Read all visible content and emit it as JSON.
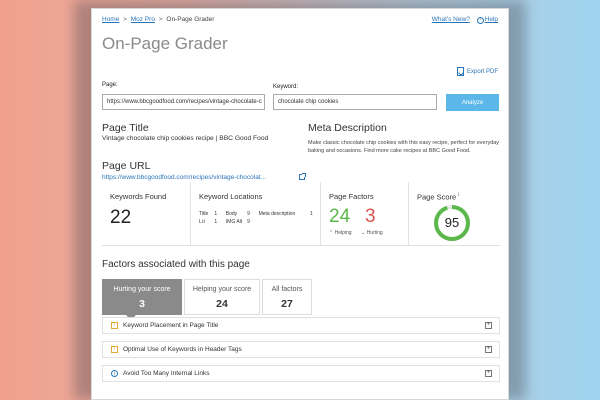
{
  "breadcrumb": {
    "home": "Home",
    "product": "Moz Pro",
    "current": "On-Page Grader",
    "sep": ">"
  },
  "toplinks": {
    "whats_new": "What's New?",
    "help_icon": "?",
    "help": "Help"
  },
  "page_title": "On-Page Grader",
  "export_label": "Export PDF",
  "form": {
    "page_label": "Page:",
    "page_value": "https://www.bbcgoodfood.com/recipes/vintage-chocolate-c",
    "keyword_label": "Keyword:",
    "keyword_value": "chocolate chip cookies",
    "analyze_label": "Analyze"
  },
  "results": {
    "page_title_heading": "Page Title",
    "page_title_value": "Vintage chocolate chip cookies recipe | BBC Good Food",
    "meta_heading": "Meta Description",
    "meta_value": "Make classic chocolate chip cookies with this easy recipe, perfect for everyday baking and occasions. Find more cake recipes at BBC Good Food.",
    "url_heading": "Page URL",
    "url_value": "https://www.bbcgoodfood.com/recipes/vintage-chocolat..."
  },
  "stats": {
    "keywords_found_label": "Keywords Found",
    "keywords_found_value": "22",
    "keyword_locations_label": "Keyword Locations",
    "locations": {
      "title_label": "Title",
      "title_value": "1",
      "body_label": "Body",
      "body_value": "9",
      "meta_label": "Meta description",
      "meta_value": "1",
      "li_label": "Li:i",
      "li_value": "1",
      "imgalt_label": "IMG Alt",
      "imgalt_value": "9"
    },
    "page_factors_label": "Page Factors",
    "helping_value": "24",
    "hurting_value": "3",
    "helping_label": "Helping",
    "hurting_label": "Hurting",
    "page_score_label": "Page Score",
    "page_score_sup": "i",
    "page_score_value": "95",
    "page_score_fraction": 0.95,
    "score_color": "#5bb84a"
  },
  "factors": {
    "heading": "Factors associated with this page",
    "tabs": [
      {
        "label": "Hurting your score",
        "count": "3"
      },
      {
        "label": "Helping your score",
        "count": "24"
      },
      {
        "label": "All factors",
        "count": "27"
      }
    ],
    "rows": [
      {
        "icon": "!",
        "label": "Keyword Placement in Page Title"
      },
      {
        "icon": "!",
        "label": "Optimal Use of Keywords in Header Tags"
      },
      {
        "icon": "i",
        "label": "Avoid Too Many Internal Links"
      }
    ],
    "expand_icon": "+"
  },
  "colors": {
    "accent": "#5bb7e8",
    "link": "#2a74b8",
    "helping": "#5bb84a",
    "hurting": "#d9534f",
    "warn": "#e3a83a"
  }
}
